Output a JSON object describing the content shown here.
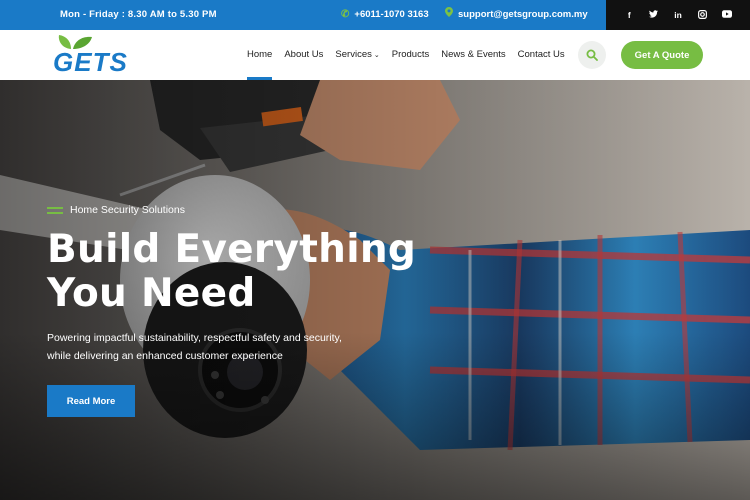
{
  "topbar": {
    "hours": "Mon - Friday : 8.30 AM to 5.30 PM",
    "phone": "+6011-1070 3163",
    "email": "support@getsgroup.com.my",
    "phone_icon": "phone-icon",
    "email_icon": "location-pin-icon",
    "social": [
      {
        "icon": "facebook-icon",
        "glyph": "f"
      },
      {
        "icon": "twitter-icon",
        "glyph": "t"
      },
      {
        "icon": "linkedin-icon",
        "glyph": "in"
      },
      {
        "icon": "instagram-icon",
        "glyph": "◙"
      },
      {
        "icon": "youtube-icon",
        "glyph": "▶"
      }
    ]
  },
  "header": {
    "logo_text": "GETS",
    "nav": [
      {
        "label": "Home",
        "active": true
      },
      {
        "label": "About Us"
      },
      {
        "label": "Services",
        "dropdown": true
      },
      {
        "label": "Products"
      },
      {
        "label": "News & Events"
      },
      {
        "label": "Contact Us"
      }
    ],
    "quote_button": "Get A Quote"
  },
  "hero": {
    "subtitle": "Home Security Solutions",
    "headline_line1": "Build Everything",
    "headline_line2": "You Need",
    "description": "Powering impactful sustainability, respectful safety and security, while delivering an enhanced customer experience",
    "cta": "Read More"
  },
  "colors": {
    "brand_blue": "#1a7ac7",
    "brand_green": "#77bd43",
    "dark": "#111111"
  }
}
